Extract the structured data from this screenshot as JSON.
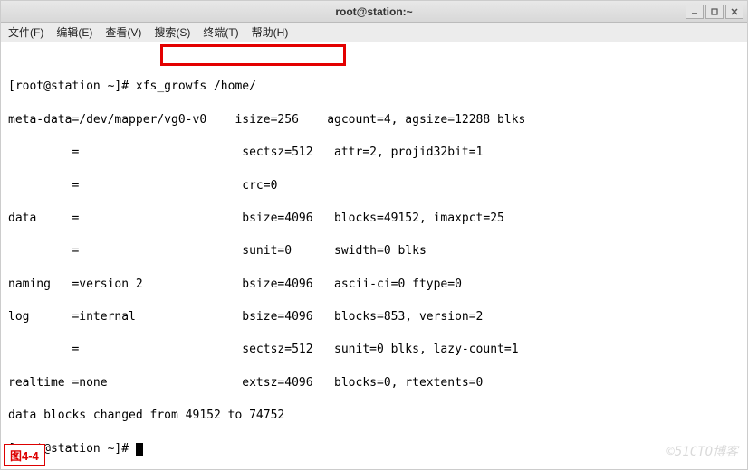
{
  "window": {
    "title": "root@station:~"
  },
  "menu": {
    "file": "文件(F)",
    "edit": "编辑(E)",
    "view": "查看(V)",
    "search": "搜索(S)",
    "terminal": "终端(T)",
    "help": "帮助(H)"
  },
  "terminal": {
    "lines": {
      "l0": "[root@station ~]# xfs_growfs /home/",
      "l1": "meta-data=/dev/mapper/vg0-v0    isize=256    agcount=4, agsize=12288 blks",
      "l2": "         =                       sectsz=512   attr=2, projid32bit=1",
      "l3": "         =                       crc=0",
      "l4": "data     =                       bsize=4096   blocks=49152, imaxpct=25",
      "l5": "         =                       sunit=0      swidth=0 blks",
      "l6": "naming   =version 2              bsize=4096   ascii-ci=0 ftype=0",
      "l7": "log      =internal               bsize=4096   blocks=853, version=2",
      "l8": "         =                       sectsz=512   sunit=0 blks, lazy-count=1",
      "l9": "realtime =none                   extsz=4096   blocks=0, rtextents=0",
      "l10": "data blocks changed from 49152 to 74752",
      "l11": "[root@station ~]# "
    }
  },
  "caption": "图4-4",
  "watermark": "©51CTO博客"
}
